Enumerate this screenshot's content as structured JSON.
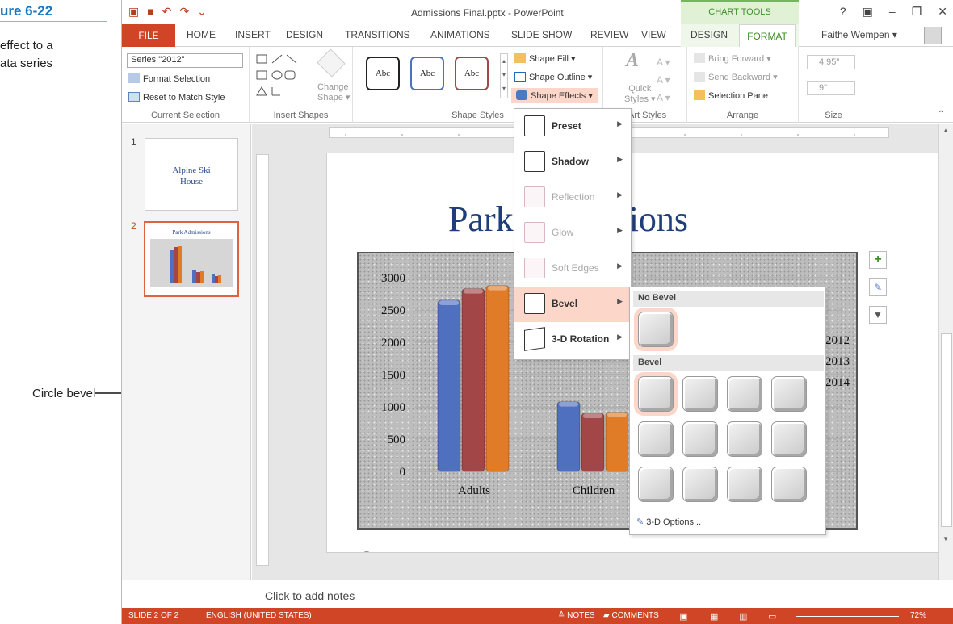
{
  "caption": {
    "figure": "ure 6-22",
    "text": "effect to a\nata series"
  },
  "callout": {
    "label": "Circle bevel"
  },
  "titlebar": {
    "title": "Admissions Final.pptx - PowerPoint",
    "context_group": "CHART TOOLS",
    "help": "?"
  },
  "tabs": {
    "file": "FILE",
    "items": [
      "HOME",
      "INSERT",
      "DESIGN",
      "TRANSITIONS",
      "ANIMATIONS",
      "SLIDE SHOW",
      "REVIEW",
      "VIEW",
      "DESIGN"
    ],
    "active": "FORMAT",
    "user": "Faithe Wempen ▾"
  },
  "ribbon": {
    "current_selection": {
      "dropdown": "Series \"2012\"",
      "format": "Format Selection",
      "reset": "Reset to Match Style",
      "label": "Current Selection"
    },
    "insert_shapes": {
      "change": "Change",
      "change2": "Shape ▾",
      "label": "Insert Shapes"
    },
    "shape_styles": {
      "abc": [
        "Abc",
        "Abc",
        "Abc"
      ],
      "fill": "Shape Fill ▾",
      "outline": "Shape Outline ▾",
      "effects": "Shape Effects ▾",
      "label": "Shape Styles"
    },
    "wordart": {
      "quick": "Quick",
      "quick2": "Styles ▾",
      "label": "dArt Styles"
    },
    "arrange": {
      "forward": "Bring Forward ▾",
      "backward": "Send Backward ▾",
      "pane": "Selection Pane",
      "label": "Arrange"
    },
    "size": {
      "height": "4.95\"",
      "width": "9\"",
      "label": "Size"
    }
  },
  "thumbs": {
    "slide1_num": "1",
    "slide1_title": "Alpine Ski\nHouse",
    "slide2_num": "2",
    "slide2_title": "Park Admissions"
  },
  "slide": {
    "title": "Park Admissions"
  },
  "chart_data": {
    "type": "bar",
    "categories": [
      "Adults",
      "Children"
    ],
    "series": [
      {
        "name": "2012",
        "values": [
          2650,
          1080
        ],
        "color": "#4f6fbf"
      },
      {
        "name": "2013",
        "values": [
          2830,
          900
        ],
        "color": "#a24648"
      },
      {
        "name": "2014",
        "values": [
          2880,
          920
        ],
        "color": "#e07b28"
      }
    ],
    "ylim": [
      0,
      3000
    ],
    "yticks": [
      "3000",
      "2500",
      "2000",
      "1500",
      "1000",
      "500",
      "0"
    ],
    "legend": "right"
  },
  "menu": {
    "items": [
      "Preset",
      "Shadow",
      "Reflection",
      "Glow",
      "Soft Edges",
      "Bevel",
      "3-D Rotation"
    ]
  },
  "gallery": {
    "no_bevel": "No Bevel",
    "bevel": "Bevel",
    "options": "3-D Options..."
  },
  "notes": {
    "placeholder": "Click to add notes"
  },
  "status": {
    "slide": "SLIDE 2 OF 2",
    "lang": "ENGLISH (UNITED STATES)",
    "notes": "≙ NOTES",
    "comments": "▰ COMMENTS",
    "zoom": "72%"
  }
}
